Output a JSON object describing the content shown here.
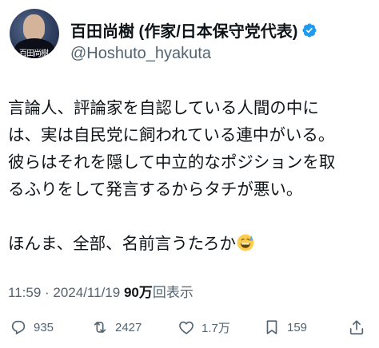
{
  "author": {
    "display_name": "百田尚樹 (作家/日本保守党代表)",
    "handle": "@Hoshuto_hyakuta",
    "avatar_signature": "百田尚樹"
  },
  "tweet": {
    "lines": [
      "言論人、評論家を自認している人間の中に",
      "は、実は自民党に飼われている連中がいる。",
      "彼らはそれを隠して中立的なポジションを取",
      "るふりをして発言するからタチが悪い。"
    ],
    "last_line": "ほんま、全部、名前言うたろか",
    "emoji": "grinning-sweat-emoji"
  },
  "meta": {
    "time": "11:59",
    "separator": " · ",
    "date": "2024/11/19",
    "views_number": "90万",
    "views_label": "回表示"
  },
  "actions": {
    "reply_count": "935",
    "retweet_count": "2427",
    "like_count": "1.7万",
    "bookmark_count": "159"
  },
  "colors": {
    "text": "#0f1419",
    "secondary": "#536471",
    "verified": "#1d9bf0"
  }
}
